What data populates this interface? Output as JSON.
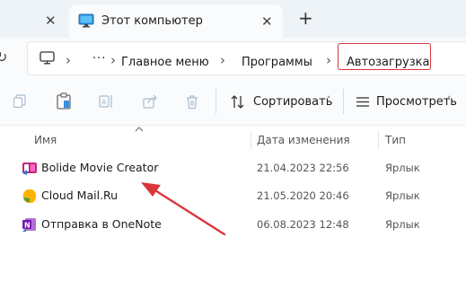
{
  "tabs": [
    {
      "label": "",
      "close_glyph": "✕"
    },
    {
      "label": "Этот компьютер",
      "close_glyph": "✕",
      "icon": "monitor-icon"
    }
  ],
  "new_tab_glyph": "+",
  "nav": {
    "refresh_glyph": "↻"
  },
  "breadcrumb": {
    "overflow": "···",
    "items": [
      "Главное меню",
      "Программы",
      "Автозагрузка"
    ],
    "separator": "›"
  },
  "toolbar": {
    "sort_label": "Сортировать",
    "view_label": "Просмотреть",
    "dropdown_glyph": "˅"
  },
  "columns": {
    "name": "Имя",
    "date": "Дата изменения",
    "type": "Тип"
  },
  "files": [
    {
      "name": "Bolide Movie Creator",
      "date": "21.04.2023 22:56",
      "type": "Ярлык",
      "icon": "bolide-movie-creator-icon"
    },
    {
      "name": "Cloud Mail.Ru",
      "date": "21.05.2020 20:46",
      "type": "Ярлык",
      "icon": "cloud-mail-icon"
    },
    {
      "name": "Отправка в OneNote",
      "date": "06.08.2023 12:48",
      "type": "Ярлык",
      "icon": "onenote-icon"
    }
  ],
  "colors": {
    "highlight": "#d9363e",
    "annotation_arrow": "#d9363e",
    "tab_strip": "#eef3f8"
  }
}
